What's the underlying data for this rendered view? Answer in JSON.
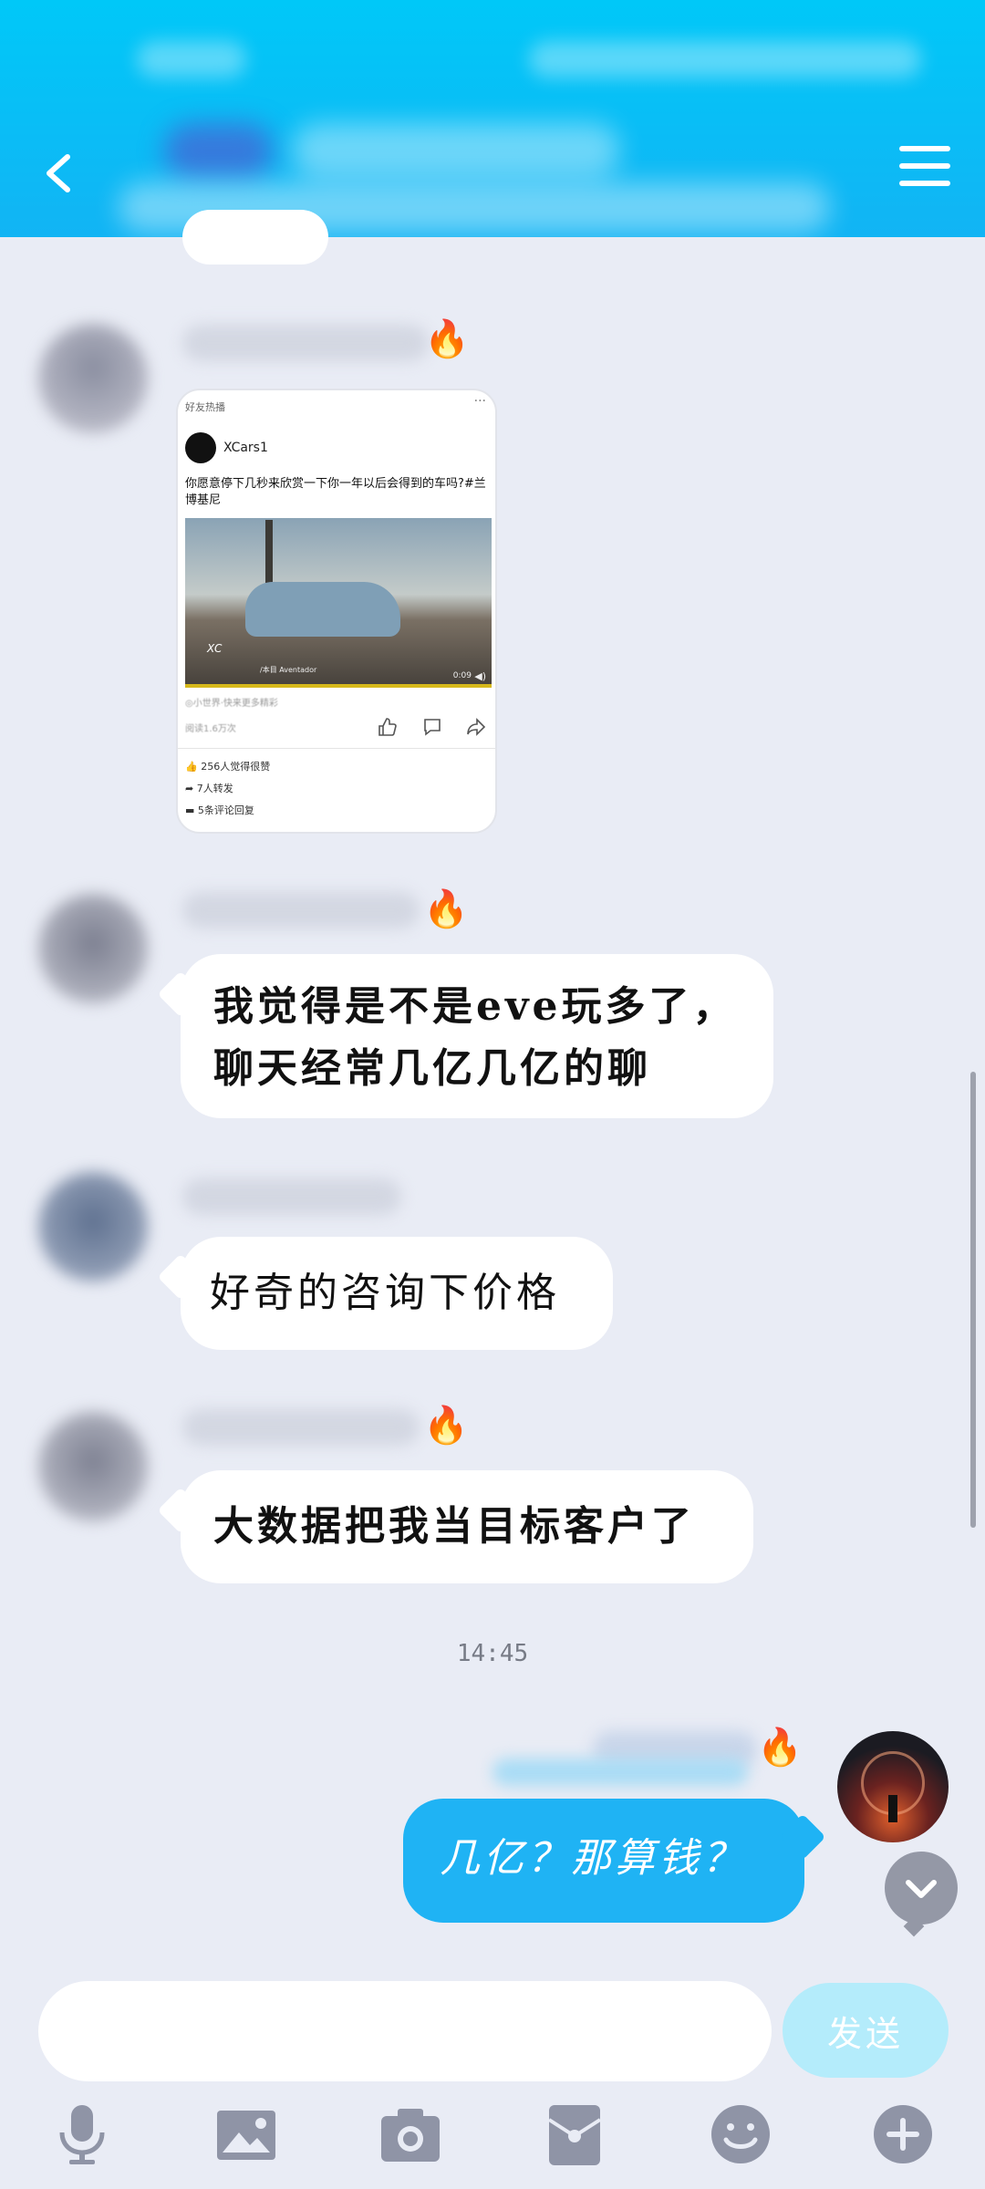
{
  "header": {
    "back_icon": "chevron-left-icon",
    "menu_icon": "hamburger-menu-icon",
    "bg_color": "#00c8f8"
  },
  "messages": [
    {
      "type": "shared_post",
      "sender": "other",
      "badge_icon": "fire-icon",
      "post": {
        "source_label": "好友热播",
        "more_label": "···",
        "author": "XCars1",
        "title": "你愿意停下几秒来欣赏一下你一年以后会得到的车吗?#兰博基尼",
        "media_caption": "/本目 Aventador",
        "watermark": "XC",
        "duration": "0:09",
        "note": "◎小世界·快来更多精彩",
        "reads": "阅读1.6万次",
        "stats": [
          "256人觉得很赞",
          "7人转发",
          "5条评论回复"
        ]
      }
    },
    {
      "type": "text",
      "sender": "other",
      "badge_icon": "fire-icon",
      "lines": [
        "我觉得是不是eve玩多了，",
        "聊天经常几亿几亿的聊"
      ]
    },
    {
      "type": "text",
      "sender": "other",
      "lines": [
        "好奇的咨询下价格"
      ]
    },
    {
      "type": "text",
      "sender": "other",
      "badge_icon": "fire-icon",
      "lines": [
        "大数据把我当目标客户了"
      ]
    }
  ],
  "timestamp": "14:45",
  "my_message": {
    "sender": "me",
    "badge_icon": "fire-icon",
    "text": "几亿？那算钱？"
  },
  "input": {
    "value": "",
    "send_label": "发送"
  },
  "toolbar": [
    "microphone-icon",
    "image-icon",
    "camera-icon",
    "red-packet-icon",
    "emoji-icon",
    "plus-icon"
  ],
  "colors": {
    "background": "#e9ecf5",
    "my_bubble": "#1fb3f4",
    "send_button": "#b4ecfb"
  }
}
